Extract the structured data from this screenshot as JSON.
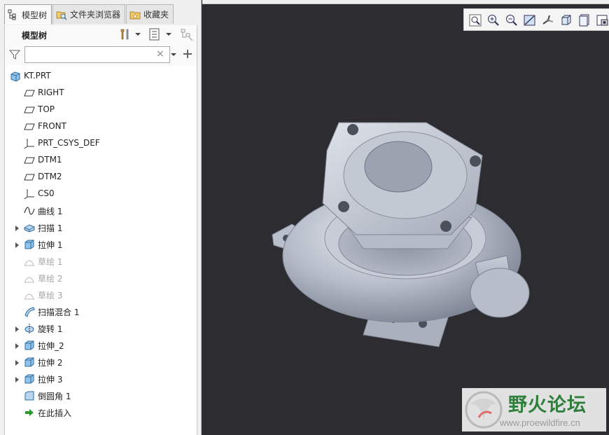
{
  "tabs": [
    {
      "label": "模型树",
      "icon": "model-tree-icon",
      "active": true
    },
    {
      "label": "文件夹浏览器",
      "icon": "folder-browser-icon",
      "active": false
    },
    {
      "label": "收藏夹",
      "icon": "favorites-icon",
      "active": false
    }
  ],
  "panel": {
    "title": "模型树",
    "filter": {
      "value": "",
      "clear_glyph": "×"
    }
  },
  "tree": {
    "root": {
      "label": "KT.PRT",
      "icon": "part-icon"
    },
    "items": [
      {
        "label": "RIGHT",
        "icon": "datum-plane-icon",
        "expandable": false,
        "suppressed": false
      },
      {
        "label": "TOP",
        "icon": "datum-plane-icon",
        "expandable": false,
        "suppressed": false
      },
      {
        "label": "FRONT",
        "icon": "datum-plane-icon",
        "expandable": false,
        "suppressed": false
      },
      {
        "label": "PRT_CSYS_DEF",
        "icon": "csys-icon",
        "expandable": false,
        "suppressed": false
      },
      {
        "label": "DTM1",
        "icon": "datum-plane-icon",
        "expandable": false,
        "suppressed": false
      },
      {
        "label": "DTM2",
        "icon": "datum-plane-icon",
        "expandable": false,
        "suppressed": false
      },
      {
        "label": "CS0",
        "icon": "csys-icon",
        "expandable": false,
        "suppressed": false
      },
      {
        "label": "曲线 1",
        "icon": "curve-icon",
        "expandable": false,
        "suppressed": false
      },
      {
        "label": "扫描 1",
        "icon": "sweep-icon",
        "expandable": true,
        "suppressed": false
      },
      {
        "label": "拉伸 1",
        "icon": "extrude-icon",
        "expandable": true,
        "suppressed": false
      },
      {
        "label": "草绘 1",
        "icon": "sketch-icon",
        "expandable": false,
        "suppressed": true
      },
      {
        "label": "草绘 2",
        "icon": "sketch-icon",
        "expandable": false,
        "suppressed": true
      },
      {
        "label": "草绘 3",
        "icon": "sketch-icon",
        "expandable": false,
        "suppressed": true
      },
      {
        "label": "扫描混合 1",
        "icon": "swept-blend-icon",
        "expandable": false,
        "suppressed": false
      },
      {
        "label": "旋转 1",
        "icon": "revolve-icon",
        "expandable": true,
        "suppressed": false
      },
      {
        "label": "拉伸_2",
        "icon": "extrude-icon",
        "expandable": true,
        "suppressed": false
      },
      {
        "label": "拉伸 2",
        "icon": "extrude-icon",
        "expandable": true,
        "suppressed": false
      },
      {
        "label": "拉伸 3",
        "icon": "extrude-icon",
        "expandable": true,
        "suppressed": false
      },
      {
        "label": "倒圆角 1",
        "icon": "round-icon",
        "expandable": false,
        "suppressed": false
      },
      {
        "label": "在此插入",
        "icon": "insert-here-icon",
        "expandable": false,
        "suppressed": false
      }
    ]
  },
  "view_toolbar": [
    "refit-icon",
    "zoom-in-icon",
    "zoom-out-icon",
    "repaint-icon",
    "spin-center-icon",
    "display-style-icon",
    "saved-views-icon",
    "named-view-icon"
  ],
  "watermark": {
    "title": "野火论坛",
    "url": "www.proewildfire.cn"
  },
  "colors": {
    "viewport_bg": "#2c2c31",
    "model": "#b9bfca",
    "watermark_green": "#2f7f3c",
    "insert_arrow": "#2e9a2e"
  }
}
